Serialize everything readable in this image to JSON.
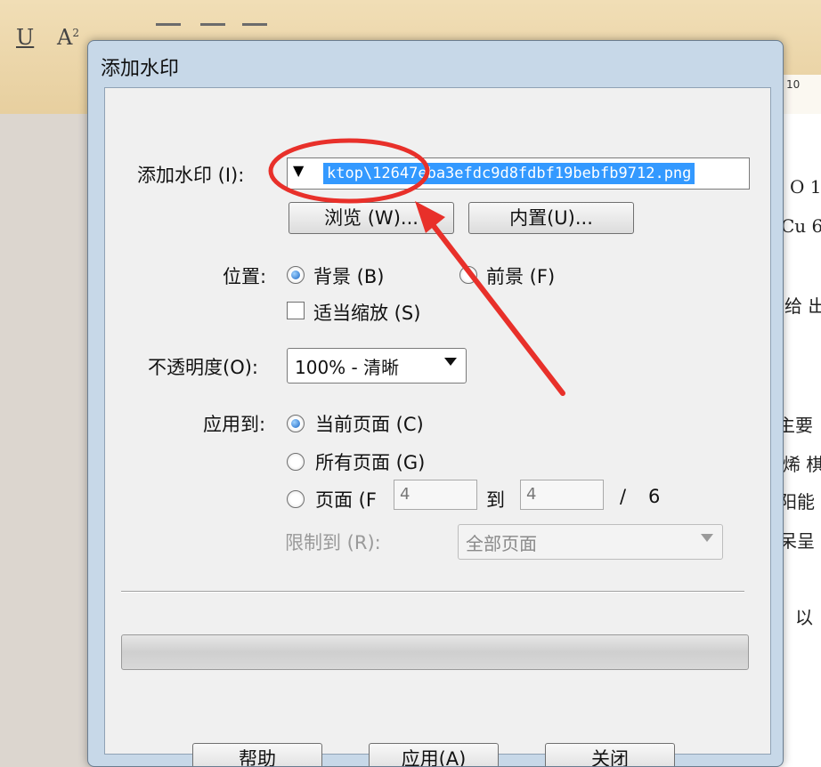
{
  "toolbar": {
    "underline_icon": "underline-icon",
    "superscript_icon": "superscript-icon",
    "ruler_label": "10"
  },
  "document": {
    "lines": [
      "O 1",
      "Cu 6",
      "给 出",
      "主要",
      "烯 棋",
      "阳能",
      "呆呈",
      "，以"
    ]
  },
  "dialog": {
    "title": "添加水印",
    "watermark_label": "添加水印 (I):",
    "watermark_path": "ktop\\12647eba3efdc9d8fdbf19bebfb9712.png",
    "browse_button": "浏览 (W)...",
    "builtin_button": "内置(U)...",
    "position_label": "位置:",
    "background_option": "背景 (B)",
    "foreground_option": "前景 (F)",
    "scale_option": "适当缩放 (S)",
    "opacity_label": "不透明度(O):",
    "opacity_value": "100% - 清晰",
    "apply_to_label": "应用到:",
    "current_page_option": "当前页面 (C)",
    "all_pages_option": "所有页面 (G)",
    "pages_option": "页面 (F",
    "page_from": "4",
    "page_to_label": "到",
    "page_to": "4",
    "page_total_sep": "/",
    "page_total": "6",
    "limit_label": "限制到 (R):",
    "limit_value": "全部页面",
    "help_button": "帮助",
    "apply_button": "应用(A)",
    "close_button": "关闭"
  },
  "colors": {
    "annotation": "#e8302a",
    "selection": "#3399ff"
  }
}
